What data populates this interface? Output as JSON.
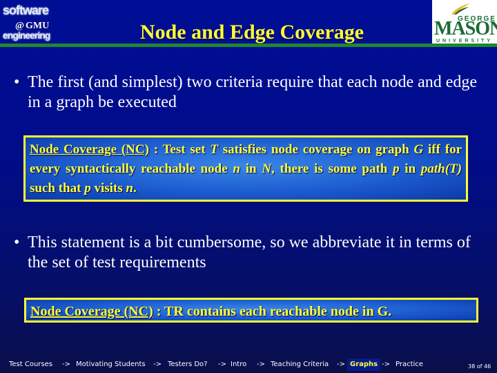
{
  "header": {
    "left_logo": {
      "line1": "software",
      "center": "GMU",
      "line3": "engineering"
    },
    "title": "Node and Edge Coverage",
    "right_logo": {
      "top": "GEORGE",
      "main": "MASON",
      "bottom": "UNIVERSITY"
    }
  },
  "bullets": [
    {
      "text": "The first (and simplest) two criteria require that each node and edge in a graph be executed"
    },
    {
      "text": "This statement is a bit cumbersome, so we abbreviate it in terms of the set of test requirements"
    }
  ],
  "definition_box": {
    "term": "Node Coverage (NC)",
    "p1": " : Test set ",
    "T": "T",
    "p2": " satisfies node coverage on graph ",
    "G": "G",
    "p3": " iff for every syntactically reachable node ",
    "n": "n",
    "p4": " in ",
    "N": "N",
    "p5": ", there is some path ",
    "p": "p",
    "p6": " in ",
    "pathT": "path(T)",
    "p7": " such that ",
    "p_b": "p",
    "p8": " visits ",
    "n_b": "n",
    "p9": "."
  },
  "tr_box": {
    "term": "Node Coverage (NC)",
    "rest": " : TR contains each reachable node in G."
  },
  "footer": {
    "nav": [
      {
        "label": "Test Courses"
      },
      {
        "label": "Motivating Students"
      },
      {
        "label": "Testers Do?"
      },
      {
        "label": "Intro"
      },
      {
        "label": "Teaching Criteria"
      },
      {
        "label": "Graphs",
        "current": true
      },
      {
        "label": "Practice"
      }
    ],
    "separator": "->",
    "page": "38",
    "of": "of",
    "total": "46"
  },
  "colors": {
    "background": "#000c8a",
    "title": "#ffff33",
    "accent_line": "#1c8a2c",
    "box_border": "#ffff33",
    "body_text": "#ffffff",
    "gmu_green": "#1a6b35"
  }
}
